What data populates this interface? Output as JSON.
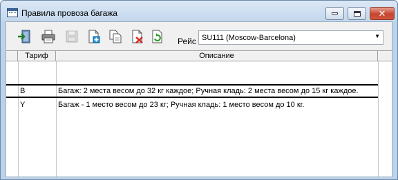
{
  "window": {
    "title": "Правила провоза багажа",
    "minimize_icon": "minimize-icon",
    "maximize_icon": "maximize-icon",
    "close_icon": "close-icon"
  },
  "toolbar": {
    "buttons": [
      {
        "name": "exit",
        "icon": "exit-door-icon"
      },
      {
        "name": "print",
        "icon": "printer-icon"
      },
      {
        "name": "save",
        "icon": "save-disk-icon"
      },
      {
        "name": "add",
        "icon": "add-document-icon"
      },
      {
        "name": "copy",
        "icon": "copy-documents-icon"
      },
      {
        "name": "delete",
        "icon": "delete-document-icon"
      },
      {
        "name": "refresh",
        "icon": "refresh-icon"
      }
    ],
    "flight_label": "Рейс",
    "flight_value": "SU111 (Moscow-Barcelona)"
  },
  "table": {
    "columns": [
      "Тариф",
      "Описание"
    ],
    "rows": [
      {
        "tarif": "B",
        "description": "Багаж: 2 места весом до 32 кг каждое; Ручная кладь: 2 места весом до 15 кг каждое."
      },
      {
        "tarif": "Y",
        "description": "Багаж - 1 место весом до 23 кг; Ручная кладь: 1 место весом до 10 кг."
      }
    ]
  },
  "colors": {
    "frame": "#bcd3ea",
    "close_button": "#c54530"
  }
}
